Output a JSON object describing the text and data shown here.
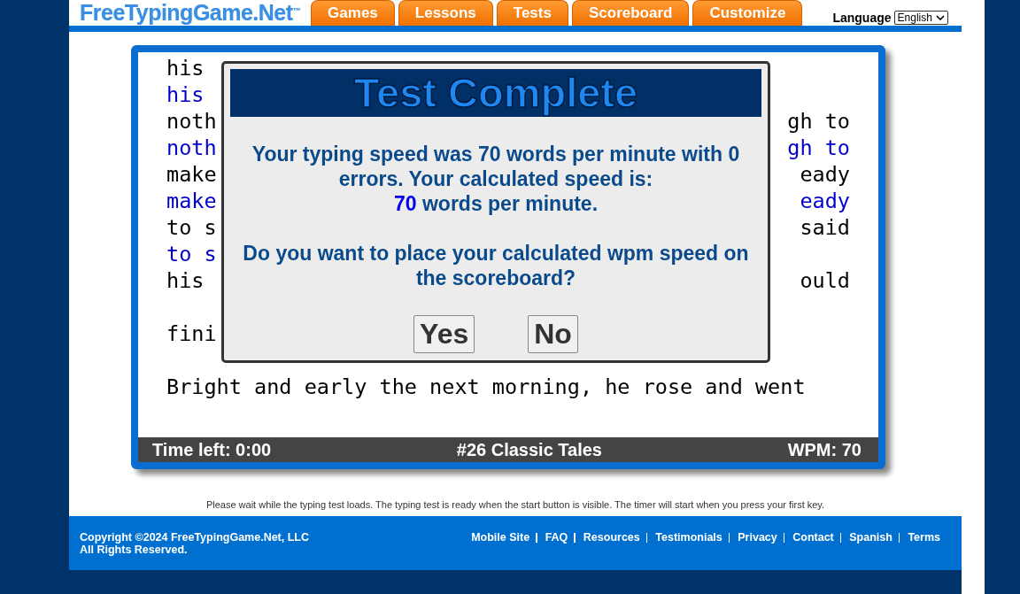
{
  "header": {
    "logo": "FreeTypingGame.Net",
    "logo_mark": "™",
    "tabs": [
      {
        "label": "Games",
        "selected": false
      },
      {
        "label": "Lessons",
        "selected": false
      },
      {
        "label": "Tests",
        "selected": false
      },
      {
        "label": "Scoreboard",
        "selected": false
      },
      {
        "label": "Customize",
        "selected": false
      }
    ],
    "language_label": "Language",
    "language_value": "English"
  },
  "test": {
    "lines": [
      {
        "kind": "source",
        "left": "his"
      },
      {
        "kind": "typed",
        "left": "his"
      },
      {
        "kind": "source",
        "left": "noth",
        "right": "gh to"
      },
      {
        "kind": "typed",
        "left": "noth",
        "right": "gh to"
      },
      {
        "kind": "source",
        "left": "make",
        "right": "eady"
      },
      {
        "kind": "typed",
        "left": "make",
        "right": "eady"
      },
      {
        "kind": "source",
        "left": "to s",
        "right": "said"
      },
      {
        "kind": "typed",
        "left": "to s"
      },
      {
        "kind": "source",
        "left": "his",
        "right": "ould"
      },
      {
        "kind": "source"
      },
      {
        "kind": "source",
        "left": "fini"
      },
      {
        "kind": "source"
      },
      {
        "kind": "source",
        "left": "Bright and early the next morning, he rose and went"
      }
    ],
    "status": {
      "time_left": "Time left: 0:00",
      "title": "#26 Classic Tales",
      "wpm": "WPM: 70"
    }
  },
  "dialog": {
    "title": "Test Complete",
    "message": "Your typing speed was 70 words per minute with 0 errors. Your calculated speed is:",
    "speed": "70",
    "speed_suffix": "words per minute.",
    "question": "Do you want to place your calculated wpm speed on the scoreboard?",
    "buttons": [
      "Yes",
      "No"
    ]
  },
  "notice": "Please wait while the typing test loads. The typing test is ready when the start button is visible. The timer will start when you press your first key.",
  "footer": {
    "copyright": "Copyright ©2024 FreeTypingGame.Net, LLC",
    "rights": "All Rights Reserved.",
    "links": [
      "Mobile Site",
      "FAQ",
      "Resources",
      "Testimonials",
      "Privacy",
      "Contact",
      "Spanish",
      "Terms"
    ]
  }
}
